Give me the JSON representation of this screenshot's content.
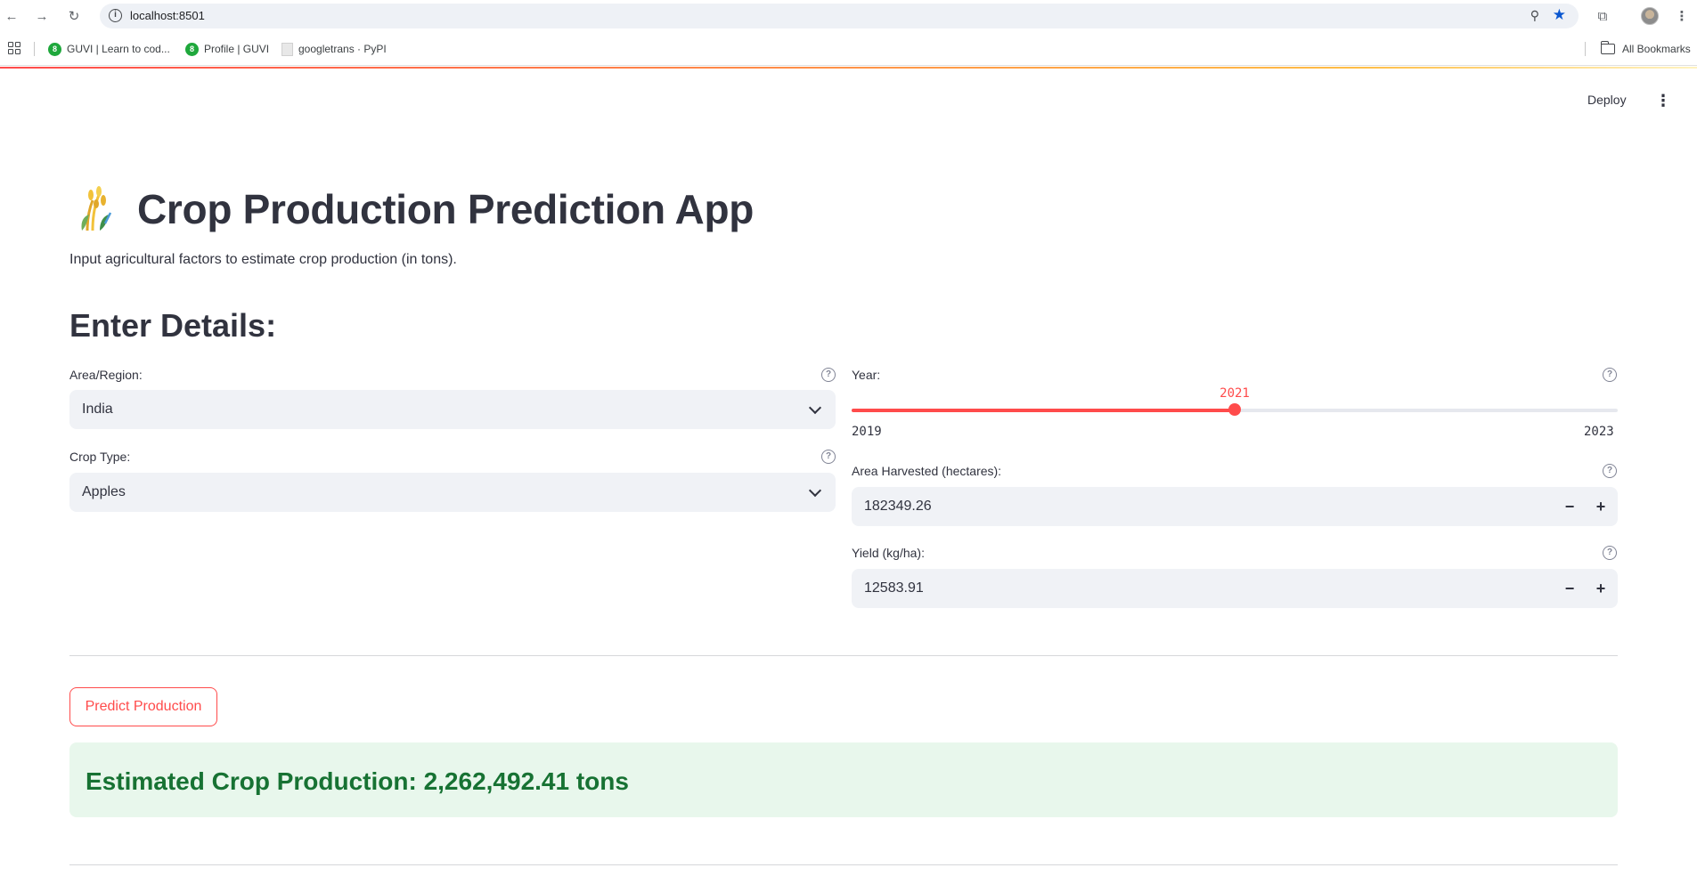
{
  "browser": {
    "url": "localhost:8501",
    "info_icon": "info-icon",
    "bookmarks": [
      {
        "label": "GUVI | Learn to cod..."
      },
      {
        "label": "Profile | GUVI"
      },
      {
        "label": "googletrans · PyPI"
      }
    ],
    "all_bookmarks": "All Bookmarks"
  },
  "app": {
    "deploy_label": "Deploy",
    "title": "Crop Production Prediction App",
    "subtitle": "Input agricultural factors to estimate crop production (in tons).",
    "section_heading": "Enter Details:"
  },
  "form": {
    "area": {
      "label": "Area/Region:",
      "value": "India"
    },
    "crop": {
      "label": "Crop Type:",
      "value": "Apples"
    },
    "year": {
      "label": "Year:",
      "value": 2021,
      "min": 2019,
      "max": 2023,
      "value_text": "2021",
      "min_text": "2019",
      "max_text": "2023"
    },
    "area_harvested": {
      "label": "Area Harvested (hectares):",
      "value": "182349.26"
    },
    "yield": {
      "label": "Yield (kg/ha):",
      "value": "12583.91"
    },
    "help_glyph": "?",
    "minus": "−",
    "plus": "+"
  },
  "predict_button": "Predict Production",
  "result": "Estimated Crop Production: 2,262,492.41 tons",
  "colors": {
    "accent": "#ff4b4b",
    "success_bg": "#e8f7ec",
    "success_text": "#177233"
  }
}
